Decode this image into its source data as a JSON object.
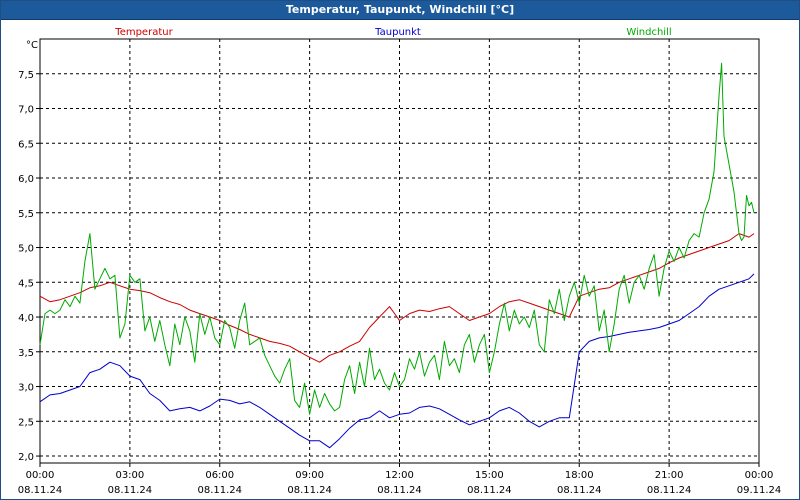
{
  "window": {
    "title": "Temperatur, Taupunkt, Windchill [°C]"
  },
  "chart_data": {
    "type": "line",
    "title": "Temperatur, Taupunkt, Windchill [°C]",
    "ylabel": "°C",
    "ylim": [
      1.9,
      8.0
    ],
    "grid": true,
    "x_start": "08.11.24 00:00",
    "x_end": "09.11.24 00:00",
    "x_ticks": [
      {
        "time": "00:00",
        "date": "08.11.24"
      },
      {
        "time": "03:00",
        "date": "08.11.24"
      },
      {
        "time": "06:00",
        "date": "08.11.24"
      },
      {
        "time": "09:00",
        "date": "08.11.24"
      },
      {
        "time": "12:00",
        "date": "08.11.24"
      },
      {
        "time": "15:00",
        "date": "08.11.24"
      },
      {
        "time": "18:00",
        "date": "08.11.24"
      },
      {
        "time": "21:00",
        "date": "08.11.24"
      },
      {
        "time": "00:00",
        "date": "09.11.24"
      }
    ],
    "y_ticks": [
      "2,0",
      "2,5",
      "3,0",
      "3,5",
      "4,0",
      "4,5",
      "5,0",
      "5,5",
      "6,0",
      "6,5",
      "7,0",
      "7,5"
    ],
    "y_tick_values": [
      2.0,
      2.5,
      3.0,
      3.5,
      4.0,
      4.5,
      5.0,
      5.5,
      6.0,
      6.5,
      7.0,
      7.5
    ],
    "series": [
      {
        "name": "Temperatur",
        "color": "#cc0000",
        "points": [
          [
            "00:00",
            4.3
          ],
          [
            "00:20",
            4.22
          ],
          [
            "00:40",
            4.25
          ],
          [
            "01:00",
            4.3
          ],
          [
            "01:20",
            4.35
          ],
          [
            "01:40",
            4.42
          ],
          [
            "02:00",
            4.45
          ],
          [
            "02:20",
            4.5
          ],
          [
            "02:40",
            4.45
          ],
          [
            "03:00",
            4.4
          ],
          [
            "03:20",
            4.38
          ],
          [
            "03:40",
            4.35
          ],
          [
            "04:00",
            4.28
          ],
          [
            "04:20",
            4.22
          ],
          [
            "04:40",
            4.18
          ],
          [
            "05:00",
            4.1
          ],
          [
            "05:20",
            4.05
          ],
          [
            "05:40",
            4.0
          ],
          [
            "06:00",
            3.95
          ],
          [
            "06:20",
            3.88
          ],
          [
            "06:40",
            3.82
          ],
          [
            "07:00",
            3.75
          ],
          [
            "07:20",
            3.7
          ],
          [
            "07:40",
            3.65
          ],
          [
            "08:00",
            3.62
          ],
          [
            "08:20",
            3.58
          ],
          [
            "08:40",
            3.5
          ],
          [
            "09:00",
            3.42
          ],
          [
            "09:20",
            3.35
          ],
          [
            "09:40",
            3.45
          ],
          [
            "10:00",
            3.5
          ],
          [
            "10:20",
            3.58
          ],
          [
            "10:40",
            3.65
          ],
          [
            "11:00",
            3.85
          ],
          [
            "11:20",
            4.0
          ],
          [
            "11:40",
            4.15
          ],
          [
            "12:00",
            3.95
          ],
          [
            "12:20",
            4.05
          ],
          [
            "12:40",
            4.1
          ],
          [
            "13:00",
            4.08
          ],
          [
            "13:20",
            4.12
          ],
          [
            "13:40",
            4.15
          ],
          [
            "14:00",
            4.05
          ],
          [
            "14:20",
            3.95
          ],
          [
            "14:40",
            4.0
          ],
          [
            "15:00",
            4.05
          ],
          [
            "15:20",
            4.15
          ],
          [
            "15:40",
            4.22
          ],
          [
            "16:00",
            4.25
          ],
          [
            "16:20",
            4.2
          ],
          [
            "16:40",
            4.15
          ],
          [
            "17:00",
            4.1
          ],
          [
            "17:20",
            4.05
          ],
          [
            "17:40",
            4.0
          ],
          [
            "18:00",
            4.3
          ],
          [
            "18:20",
            4.35
          ],
          [
            "18:40",
            4.4
          ],
          [
            "19:00",
            4.42
          ],
          [
            "19:20",
            4.5
          ],
          [
            "19:40",
            4.55
          ],
          [
            "20:00",
            4.6
          ],
          [
            "20:20",
            4.65
          ],
          [
            "20:40",
            4.7
          ],
          [
            "21:00",
            4.78
          ],
          [
            "21:20",
            4.85
          ],
          [
            "21:40",
            4.9
          ],
          [
            "22:00",
            4.95
          ],
          [
            "22:20",
            5.0
          ],
          [
            "22:40",
            5.05
          ],
          [
            "23:00",
            5.1
          ],
          [
            "23:20",
            5.2
          ],
          [
            "23:40",
            5.15
          ],
          [
            "23:50",
            5.2
          ]
        ]
      },
      {
        "name": "Taupunkt",
        "color": "#0000cc",
        "points": [
          [
            "00:00",
            2.78
          ],
          [
            "00:20",
            2.88
          ],
          [
            "00:40",
            2.9
          ],
          [
            "01:00",
            2.95
          ],
          [
            "01:20",
            3.0
          ],
          [
            "01:40",
            3.2
          ],
          [
            "02:00",
            3.25
          ],
          [
            "02:20",
            3.35
          ],
          [
            "02:40",
            3.3
          ],
          [
            "03:00",
            3.15
          ],
          [
            "03:20",
            3.1
          ],
          [
            "03:40",
            2.9
          ],
          [
            "04:00",
            2.8
          ],
          [
            "04:20",
            2.65
          ],
          [
            "04:40",
            2.68
          ],
          [
            "05:00",
            2.7
          ],
          [
            "05:20",
            2.65
          ],
          [
            "05:40",
            2.72
          ],
          [
            "06:00",
            2.82
          ],
          [
            "06:20",
            2.8
          ],
          [
            "06:40",
            2.75
          ],
          [
            "07:00",
            2.78
          ],
          [
            "07:20",
            2.7
          ],
          [
            "07:40",
            2.6
          ],
          [
            "08:00",
            2.5
          ],
          [
            "08:20",
            2.4
          ],
          [
            "08:40",
            2.3
          ],
          [
            "09:00",
            2.22
          ],
          [
            "09:20",
            2.22
          ],
          [
            "09:40",
            2.12
          ],
          [
            "10:00",
            2.25
          ],
          [
            "10:20",
            2.4
          ],
          [
            "10:40",
            2.52
          ],
          [
            "11:00",
            2.55
          ],
          [
            "11:20",
            2.65
          ],
          [
            "11:40",
            2.55
          ],
          [
            "12:00",
            2.6
          ],
          [
            "12:20",
            2.62
          ],
          [
            "12:40",
            2.7
          ],
          [
            "13:00",
            2.72
          ],
          [
            "13:20",
            2.68
          ],
          [
            "13:40",
            2.6
          ],
          [
            "14:00",
            2.52
          ],
          [
            "14:20",
            2.45
          ],
          [
            "14:40",
            2.5
          ],
          [
            "15:00",
            2.55
          ],
          [
            "15:20",
            2.65
          ],
          [
            "15:40",
            2.7
          ],
          [
            "16:00",
            2.62
          ],
          [
            "16:20",
            2.5
          ],
          [
            "16:40",
            2.42
          ],
          [
            "17:00",
            2.5
          ],
          [
            "17:20",
            2.55
          ],
          [
            "17:40",
            2.55
          ],
          [
            "18:00",
            3.5
          ],
          [
            "18:20",
            3.65
          ],
          [
            "18:40",
            3.7
          ],
          [
            "19:00",
            3.72
          ],
          [
            "19:20",
            3.75
          ],
          [
            "19:40",
            3.78
          ],
          [
            "20:00",
            3.8
          ],
          [
            "20:20",
            3.82
          ],
          [
            "20:40",
            3.85
          ],
          [
            "21:00",
            3.9
          ],
          [
            "21:20",
            3.95
          ],
          [
            "21:40",
            4.05
          ],
          [
            "22:00",
            4.15
          ],
          [
            "22:20",
            4.3
          ],
          [
            "22:40",
            4.4
          ],
          [
            "23:00",
            4.45
          ],
          [
            "23:20",
            4.5
          ],
          [
            "23:40",
            4.55
          ],
          [
            "23:50",
            4.62
          ]
        ]
      },
      {
        "name": "Windchill",
        "color": "#00aa00",
        "points": [
          [
            "00:00",
            3.6
          ],
          [
            "00:10",
            4.05
          ],
          [
            "00:20",
            4.1
          ],
          [
            "00:30",
            4.05
          ],
          [
            "00:40",
            4.1
          ],
          [
            "00:50",
            4.25
          ],
          [
            "01:00",
            4.15
          ],
          [
            "01:10",
            4.3
          ],
          [
            "01:20",
            4.2
          ],
          [
            "01:30",
            4.8
          ],
          [
            "01:40",
            5.2
          ],
          [
            "01:50",
            4.4
          ],
          [
            "02:00",
            4.55
          ],
          [
            "02:10",
            4.7
          ],
          [
            "02:20",
            4.55
          ],
          [
            "02:30",
            4.6
          ],
          [
            "02:40",
            3.7
          ],
          [
            "02:50",
            3.9
          ],
          [
            "03:00",
            4.6
          ],
          [
            "03:10",
            4.5
          ],
          [
            "03:20",
            4.55
          ],
          [
            "03:30",
            3.8
          ],
          [
            "03:40",
            4.0
          ],
          [
            "03:50",
            3.65
          ],
          [
            "04:00",
            3.95
          ],
          [
            "04:10",
            3.6
          ],
          [
            "04:20",
            3.3
          ],
          [
            "04:30",
            3.9
          ],
          [
            "04:40",
            3.6
          ],
          [
            "04:50",
            4.0
          ],
          [
            "05:00",
            3.8
          ],
          [
            "05:10",
            3.35
          ],
          [
            "05:20",
            4.05
          ],
          [
            "05:30",
            3.75
          ],
          [
            "05:40",
            4.0
          ],
          [
            "05:50",
            3.7
          ],
          [
            "06:00",
            3.6
          ],
          [
            "06:10",
            3.95
          ],
          [
            "06:20",
            3.85
          ],
          [
            "06:30",
            3.55
          ],
          [
            "06:40",
            3.95
          ],
          [
            "06:50",
            4.2
          ],
          [
            "07:00",
            3.6
          ],
          [
            "07:10",
            3.65
          ],
          [
            "07:20",
            3.7
          ],
          [
            "07:30",
            3.45
          ],
          [
            "07:40",
            3.3
          ],
          [
            "07:50",
            3.15
          ],
          [
            "08:00",
            3.05
          ],
          [
            "08:10",
            3.25
          ],
          [
            "08:20",
            3.4
          ],
          [
            "08:30",
            2.8
          ],
          [
            "08:40",
            2.7
          ],
          [
            "08:50",
            3.05
          ],
          [
            "09:00",
            2.6
          ],
          [
            "09:10",
            2.95
          ],
          [
            "09:20",
            2.7
          ],
          [
            "09:30",
            2.9
          ],
          [
            "09:40",
            2.75
          ],
          [
            "09:50",
            2.65
          ],
          [
            "10:00",
            2.7
          ],
          [
            "10:10",
            3.1
          ],
          [
            "10:20",
            3.3
          ],
          [
            "10:30",
            2.9
          ],
          [
            "10:40",
            3.35
          ],
          [
            "10:50",
            3.0
          ],
          [
            "11:00",
            3.55
          ],
          [
            "11:10",
            3.1
          ],
          [
            "11:20",
            3.25
          ],
          [
            "11:30",
            3.05
          ],
          [
            "11:40",
            2.95
          ],
          [
            "11:50",
            3.2
          ],
          [
            "12:00",
            3.0
          ],
          [
            "12:10",
            3.1
          ],
          [
            "12:20",
            3.4
          ],
          [
            "12:30",
            3.25
          ],
          [
            "12:40",
            3.5
          ],
          [
            "12:50",
            3.15
          ],
          [
            "13:00",
            3.35
          ],
          [
            "13:10",
            3.45
          ],
          [
            "13:20",
            3.1
          ],
          [
            "13:30",
            3.65
          ],
          [
            "13:40",
            3.3
          ],
          [
            "13:50",
            3.4
          ],
          [
            "14:00",
            3.2
          ],
          [
            "14:10",
            3.6
          ],
          [
            "14:20",
            3.75
          ],
          [
            "14:30",
            3.35
          ],
          [
            "14:40",
            3.6
          ],
          [
            "14:50",
            3.75
          ],
          [
            "15:00",
            3.2
          ],
          [
            "15:10",
            3.5
          ],
          [
            "15:20",
            3.9
          ],
          [
            "15:30",
            4.2
          ],
          [
            "15:40",
            3.8
          ],
          [
            "15:50",
            4.1
          ],
          [
            "16:00",
            3.9
          ],
          [
            "16:10",
            4.0
          ],
          [
            "16:20",
            3.85
          ],
          [
            "16:30",
            4.1
          ],
          [
            "16:40",
            3.6
          ],
          [
            "16:50",
            3.5
          ],
          [
            "17:00",
            4.25
          ],
          [
            "17:10",
            4.05
          ],
          [
            "17:20",
            4.4
          ],
          [
            "17:30",
            3.95
          ],
          [
            "17:40",
            4.3
          ],
          [
            "17:50",
            4.5
          ],
          [
            "18:00",
            4.2
          ],
          [
            "18:10",
            4.6
          ],
          [
            "18:20",
            4.3
          ],
          [
            "18:30",
            4.45
          ],
          [
            "18:40",
            3.8
          ],
          [
            "18:50",
            4.1
          ],
          [
            "19:00",
            3.5
          ],
          [
            "19:10",
            3.9
          ],
          [
            "19:20",
            4.4
          ],
          [
            "19:30",
            4.6
          ],
          [
            "19:40",
            4.2
          ],
          [
            "19:50",
            4.5
          ],
          [
            "20:00",
            4.6
          ],
          [
            "20:10",
            4.4
          ],
          [
            "20:20",
            4.7
          ],
          [
            "20:30",
            4.9
          ],
          [
            "20:40",
            4.3
          ],
          [
            "20:50",
            4.7
          ],
          [
            "21:00",
            4.95
          ],
          [
            "21:10",
            4.8
          ],
          [
            "21:20",
            5.0
          ],
          [
            "21:30",
            4.85
          ],
          [
            "21:40",
            5.1
          ],
          [
            "21:50",
            5.2
          ],
          [
            "22:00",
            5.15
          ],
          [
            "22:10",
            5.5
          ],
          [
            "22:20",
            5.7
          ],
          [
            "22:30",
            6.1
          ],
          [
            "22:40",
            7.2
          ],
          [
            "22:45",
            7.65
          ],
          [
            "22:50",
            6.6
          ],
          [
            "23:00",
            6.2
          ],
          [
            "23:10",
            5.8
          ],
          [
            "23:20",
            5.2
          ],
          [
            "23:25",
            5.1
          ],
          [
            "23:30",
            5.15
          ],
          [
            "23:35",
            5.75
          ],
          [
            "23:40",
            5.6
          ],
          [
            "23:45",
            5.65
          ],
          [
            "23:50",
            5.5
          ]
        ]
      }
    ]
  }
}
